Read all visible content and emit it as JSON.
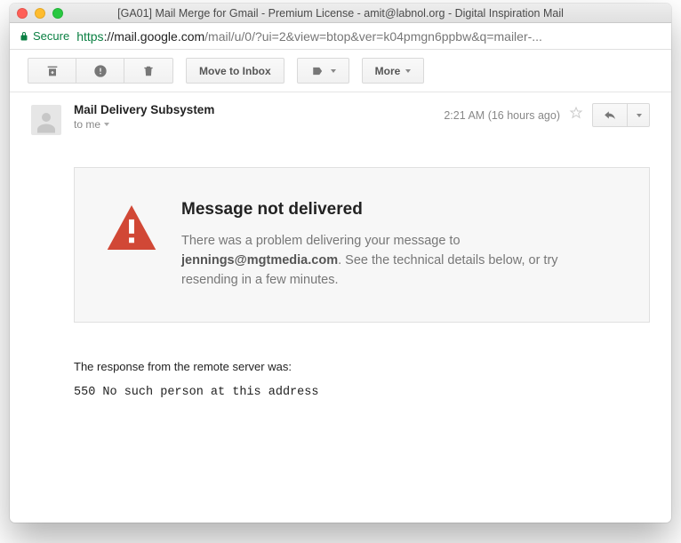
{
  "window": {
    "title": "[GA01] Mail Merge for Gmail - Premium License - amit@labnol.org - Digital Inspiration Mail"
  },
  "addressbar": {
    "secure_label": "Secure",
    "scheme": "https",
    "host": "://mail.google.com",
    "path": "/mail/u/0/?ui=2&view=btop&ver=k04pmgn6ppbw&q=mailer-..."
  },
  "toolbar": {
    "move_to_inbox": "Move to Inbox",
    "more": "More"
  },
  "message": {
    "from": "Mail Delivery Subsystem",
    "to_prefix": "to me",
    "time": "2:21 AM (16 hours ago)"
  },
  "error": {
    "heading": "Message not delivered",
    "line1": "There was a problem delivering your message to ",
    "address": "jennings@mgtmedia.com",
    "line2": ". See the technical details below, or try resending in a few minutes."
  },
  "response": {
    "intro": "The response from the remote server was:",
    "code": "550 No such person at this address"
  }
}
